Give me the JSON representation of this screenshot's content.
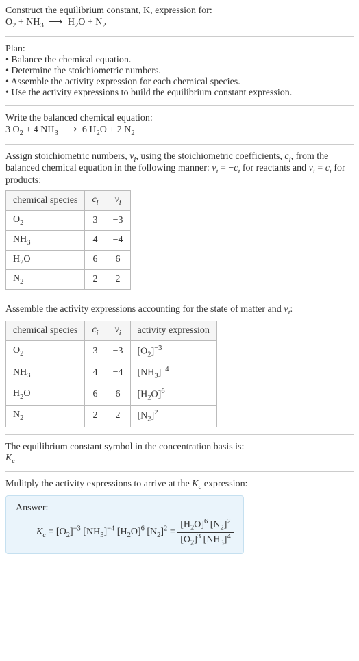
{
  "intro": {
    "line1": "Construct the equilibrium constant, K, expression for:",
    "eq_lhs1": "O",
    "eq_lhs1_sub": "2",
    "eq_plus1": " + NH",
    "eq_plus1_sub": "3",
    "eq_arrow": "⟶",
    "eq_rhs1": "H",
    "eq_rhs1_sub": "2",
    "eq_rhs1b": "O + N",
    "eq_rhs1b_sub": "2"
  },
  "plan": {
    "heading": "Plan:",
    "b1": "• Balance the chemical equation.",
    "b2": "• Determine the stoichiometric numbers.",
    "b3": "• Assemble the activity expression for each chemical species.",
    "b4": "• Use the activity expressions to build the equilibrium constant expression."
  },
  "balanced": {
    "heading": "Write the balanced chemical equation:",
    "c1": "3 O",
    "c1s": "2",
    "p1": " + 4 NH",
    "p1s": "3",
    "arrow": "⟶",
    "r1": "6 H",
    "r1s": "2",
    "r1b": "O + 2 N",
    "r1bs": "2"
  },
  "assign": {
    "text_a": "Assign stoichiometric numbers, ",
    "nu": "ν",
    "nu_sub": "i",
    "text_b": ", using the stoichiometric coefficients, ",
    "c": "c",
    "c_sub": "i",
    "text_c": ", from the balanced chemical equation in the following manner: ",
    "rel1a": "ν",
    "rel1as": "i",
    "rel1eq": " = −",
    "rel1b": "c",
    "rel1bs": "i",
    "text_d": " for reactants and ",
    "rel2a": "ν",
    "rel2as": "i",
    "rel2eq": " = ",
    "rel2b": "c",
    "rel2bs": "i",
    "text_e": " for products:"
  },
  "table1": {
    "h1": "chemical species",
    "h2": "c",
    "h2s": "i",
    "h3": "ν",
    "h3s": "i",
    "rows": [
      {
        "sp_a": "O",
        "sp_s": "2",
        "c": "3",
        "v": "−3"
      },
      {
        "sp_a": "NH",
        "sp_s": "3",
        "c": "4",
        "v": "−4"
      },
      {
        "sp_a": "H",
        "sp_s": "2",
        "sp_b": "O",
        "c": "6",
        "v": "6"
      },
      {
        "sp_a": "N",
        "sp_s": "2",
        "c": "2",
        "v": "2"
      }
    ]
  },
  "assemble": {
    "text_a": "Assemble the activity expressions accounting for the state of matter and ",
    "nu": "ν",
    "nu_s": "i",
    "text_b": ":"
  },
  "table2": {
    "h1": "chemical species",
    "h2": "c",
    "h2s": "i",
    "h3": "ν",
    "h3s": "i",
    "h4": "activity expression",
    "rows": [
      {
        "sp_a": "O",
        "sp_s": "2",
        "c": "3",
        "v": "−3",
        "ae_b": "[O",
        "ae_bs": "2",
        "ae_c": "]",
        "ae_e": "−3"
      },
      {
        "sp_a": "NH",
        "sp_s": "3",
        "c": "4",
        "v": "−4",
        "ae_b": "[NH",
        "ae_bs": "3",
        "ae_c": "]",
        "ae_e": "−4"
      },
      {
        "sp_a": "H",
        "sp_s": "2",
        "sp_b": "O",
        "c": "6",
        "v": "6",
        "ae_b": "[H",
        "ae_bs": "2",
        "ae_c": "O]",
        "ae_e": "6"
      },
      {
        "sp_a": "N",
        "sp_s": "2",
        "c": "2",
        "v": "2",
        "ae_b": "[N",
        "ae_bs": "2",
        "ae_c": "]",
        "ae_e": "2"
      }
    ]
  },
  "symbol": {
    "line1": "The equilibrium constant symbol in the concentration basis is:",
    "Kc_a": "K",
    "Kc_s": "c"
  },
  "multiply": {
    "text_a": "Mulitply the activity expressions to arrive at the ",
    "K": "K",
    "Ks": "c",
    "text_b": " expression:"
  },
  "answer": {
    "label": "Answer:",
    "K": "K",
    "Ks": "c",
    "eq": " = ",
    "t1": "[O",
    "t1s": "2",
    "t1c": "]",
    "t1e": "−3",
    "t2": " [NH",
    "t2s": "3",
    "t2c": "]",
    "t2e": "−4",
    "t3": " [H",
    "t3s": "2",
    "t3c": "O]",
    "t3e": "6",
    "t4": " [N",
    "t4s": "2",
    "t4c": "]",
    "t4e": "2",
    "eq2": " = ",
    "num1": "[H",
    "num1s": "2",
    "num1c": "O]",
    "num1e": "6",
    "num2": " [N",
    "num2s": "2",
    "num2c": "]",
    "num2e": "2",
    "den1": "[O",
    "den1s": "2",
    "den1c": "]",
    "den1e": "3",
    "den2": " [NH",
    "den2s": "3",
    "den2c": "]",
    "den2e": "4"
  }
}
